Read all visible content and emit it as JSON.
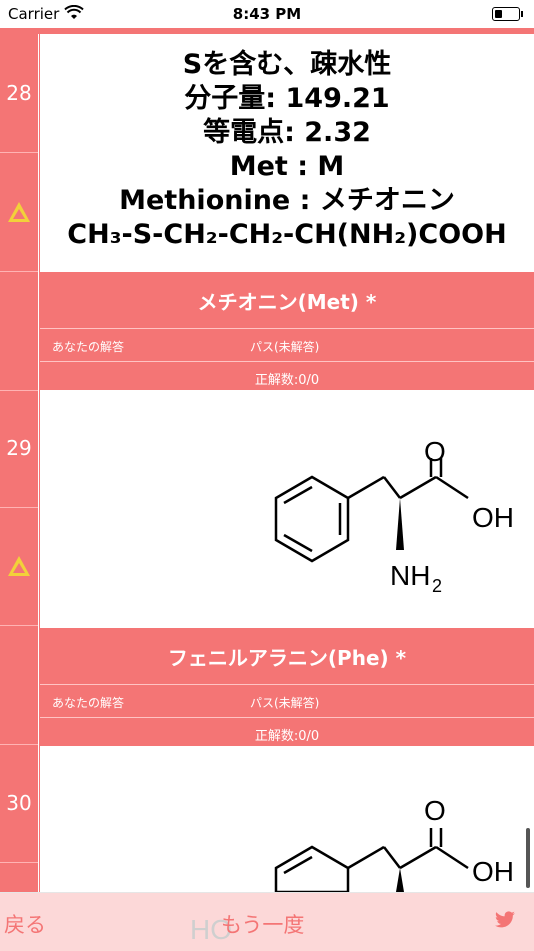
{
  "status": {
    "carrier": "Carrier",
    "time": "8:43 PM"
  },
  "rows": [
    {
      "number": "28"
    },
    {
      "number": "29"
    },
    {
      "number": "30"
    }
  ],
  "met": {
    "line1": "Sを含む、疎水性",
    "line2": "分子量: 149.21",
    "line3": "等電点: 2.32",
    "line4": "Met : M",
    "line5": "Methionine : メチオニン",
    "formula": "CH₃-S-CH₂-CH₂-CH(NH₂)COOH"
  },
  "answer1": {
    "title": "メチオニン(Met) *",
    "your_answer_label": "あなたの解答",
    "your_answer_value": "パス(未解答)",
    "count": "正解数:0/0"
  },
  "answer2": {
    "title": "フェニルアラニン(Phe) *",
    "your_answer_label": "あなたの解答",
    "your_answer_value": "パス(未解答)",
    "count": "正解数:0/0"
  },
  "molecule": {
    "o": "O",
    "oh": "OH",
    "nh2": "NH",
    "sub2": "2",
    "ho": "HO"
  },
  "toolbar": {
    "back": "戻る",
    "again": "もう一度"
  },
  "colors": {
    "accent": "#f47575",
    "warning": "#f2d13a",
    "twitter": "#f47575"
  }
}
